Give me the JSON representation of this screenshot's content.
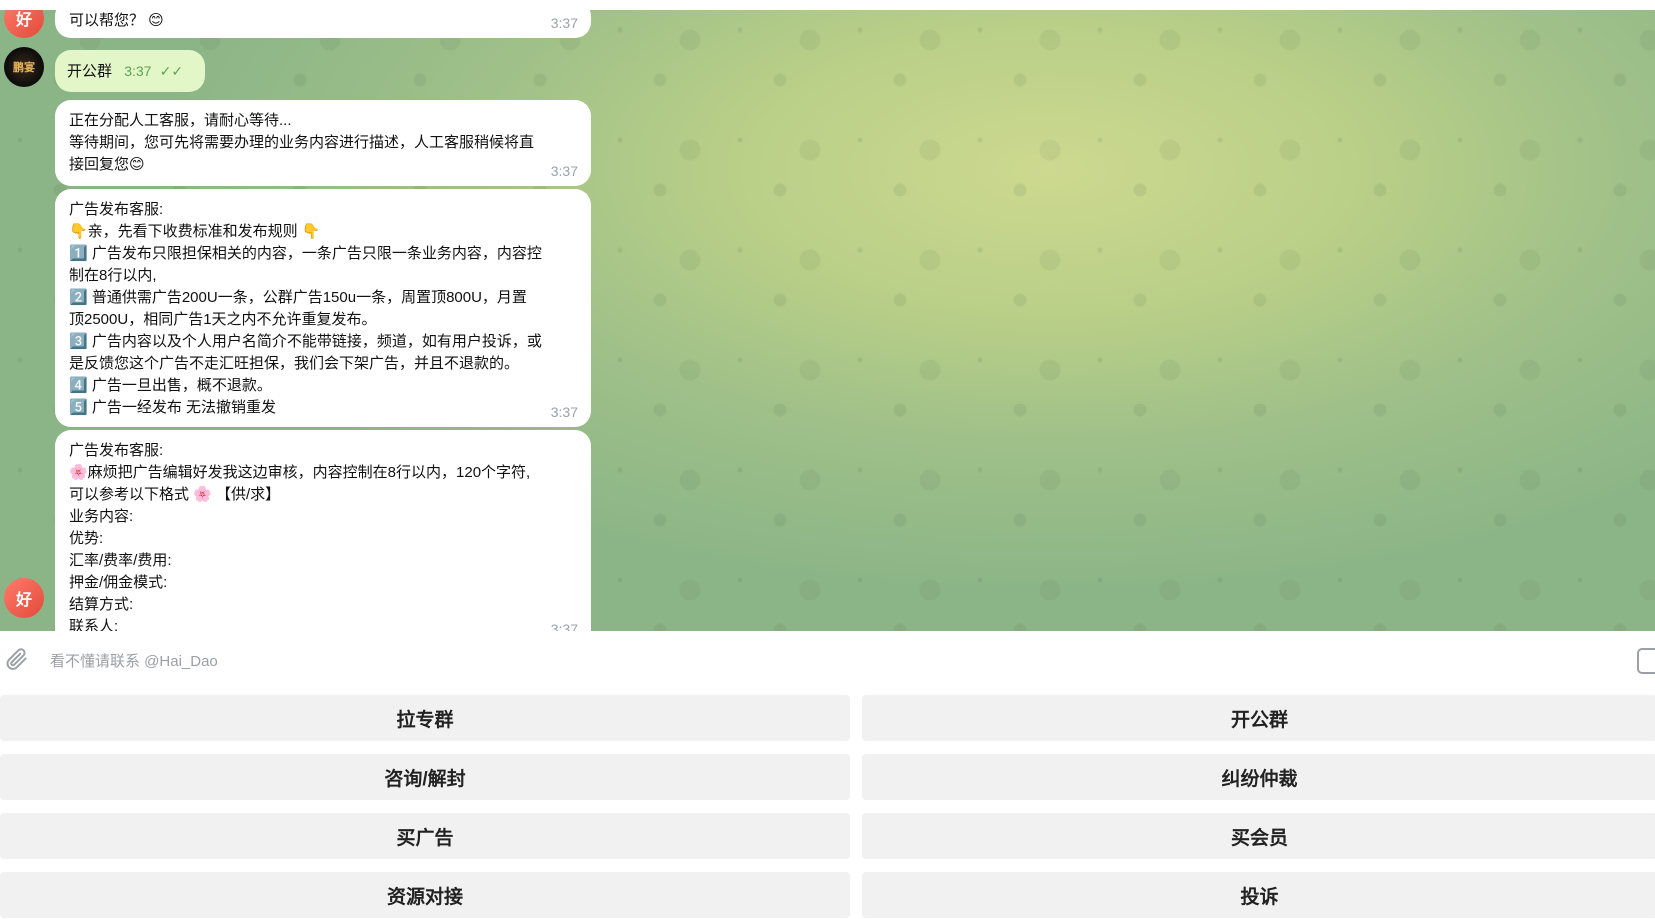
{
  "messages": [
    {
      "lines": [
        "可以帮您？ 😊"
      ],
      "time": "3:37"
    },
    {
      "lines": [
        "正在分配人工客服，请耐心等待...",
        "等待期间，您可先将需要办理的业务内容进行描述，人工客服稍候将直",
        "接回复您😊"
      ],
      "time": "3:37"
    },
    {
      "lines": [
        "广告发布客服:",
        "👇亲，先看下收费标准和发布规则 👇",
        "1️⃣ 广告发布只限担保相关的内容，一条广告只限一条业务内容，内容控",
        "制在8行以内,",
        "2️⃣ 普通供需广告200U一条，公群广告150u一条，周置顶800U，月置",
        "顶2500U，相同广告1天之内不允许重复发布。",
        "3️⃣ 广告内容以及个人用户名简介不能带链接，频道，如有用户投诉，或",
        "是反馈您这个广告不走汇旺担保，我们会下架广告，并且不退款的。",
        "4️⃣ 广告一旦出售，概不退款。",
        "5️⃣ 广告一经发布 无法撤销重发"
      ],
      "time": "3:37"
    },
    {
      "lines": [
        "广告发布客服:",
        "🌸麻烦把广告编辑好发我这边审核，内容控制在8行以内，120个字符,",
        "可以参考以下格式 🌸 【供/求】",
        "业务内容:",
        "优势:",
        "汇率/费率/费用:",
        "押金/佣金模式:",
        "结算方式:",
        "联系人:"
      ],
      "time": "3:37"
    }
  ],
  "outgoing": {
    "text": "开公群",
    "time": "3:37",
    "ticks": "✓✓"
  },
  "avatars": {
    "bot_glyph": "好",
    "user_glyph": "鹏宴"
  },
  "input": {
    "placeholder": "看不懂请联系 @Hai_Dao"
  },
  "keyboard": {
    "buttons": [
      "拉专群",
      "开公群",
      "咨询/解封",
      "纠纷仲裁",
      "买广告",
      "买会员",
      "资源对接",
      "投诉"
    ]
  },
  "colors": {
    "outgoing_bubble": "#e3f6c8",
    "incoming_bubble": "#ffffff",
    "check": "#59a64d"
  }
}
